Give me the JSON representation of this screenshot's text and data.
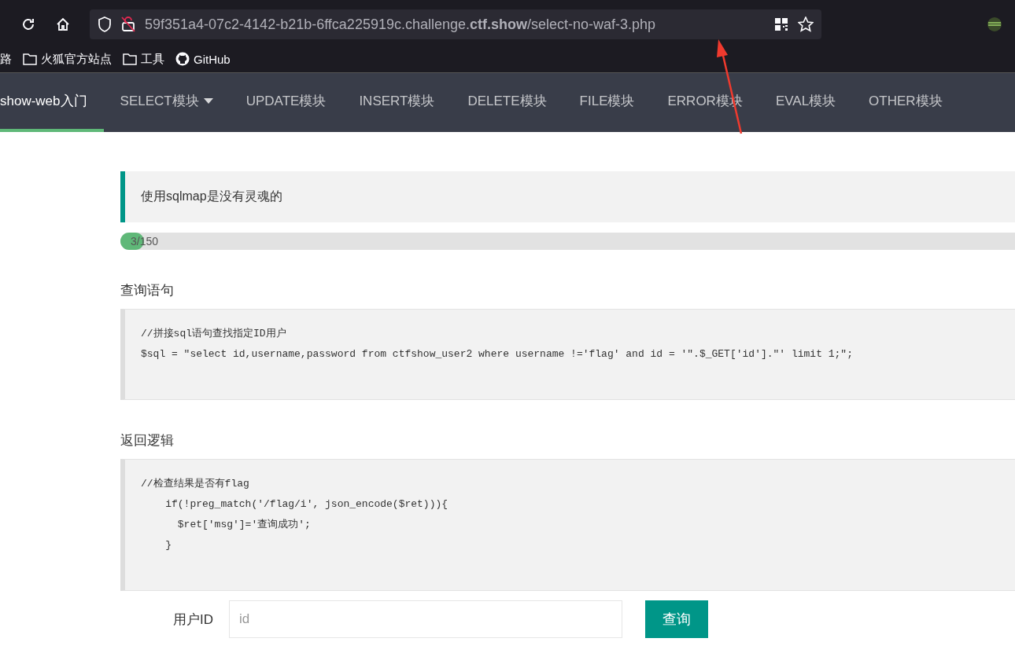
{
  "browser": {
    "url": "59f351a4-07c2-4142-b21b-6ffca225919c.challenge.**ctf.show**/select-no-waf-3.php",
    "bookmarks": [
      {
        "label": "路",
        "kind": "none"
      },
      {
        "label": "火狐官方站点",
        "kind": "folder"
      },
      {
        "label": "工具",
        "kind": "folder"
      },
      {
        "label": "GitHub",
        "kind": "github"
      }
    ]
  },
  "nav": [
    {
      "label": "show-web入门",
      "selected": true,
      "dropdown": false
    },
    {
      "label": "SELECT模块",
      "selected": false,
      "dropdown": true
    },
    {
      "label": "UPDATE模块",
      "selected": false,
      "dropdown": false
    },
    {
      "label": "INSERT模块",
      "selected": false,
      "dropdown": false
    },
    {
      "label": "DELETE模块",
      "selected": false,
      "dropdown": false
    },
    {
      "label": "FILE模块",
      "selected": false,
      "dropdown": false
    },
    {
      "label": "ERROR模块",
      "selected": false,
      "dropdown": false
    },
    {
      "label": "EVAL模块",
      "selected": false,
      "dropdown": false
    },
    {
      "label": "OTHER模块",
      "selected": false,
      "dropdown": false
    }
  ],
  "notice": "使用sqlmap是没有灵魂的",
  "progress": {
    "level": 0.02,
    "reading": "3/150"
  },
  "sections": [
    {
      "title": "查询语句",
      "code": [
        "//拼接sql语句查找指定ID用户",
        "$sql = \"select id,username,password from ctfshow_user2 where username !='flag' and id = '\".$_GET['id'].\"' limit 1;\";"
      ]
    },
    {
      "title": "返回逻辑",
      "code": [
        "//检查结果是否有flag",
        "    if(!preg_match('/flag/i', json_encode($ret))){",
        "      $ret['msg']='查询成功';",
        "    }"
      ]
    }
  ],
  "form": {
    "label": "用户ID",
    "placeholder": "id",
    "button": "查询"
  }
}
